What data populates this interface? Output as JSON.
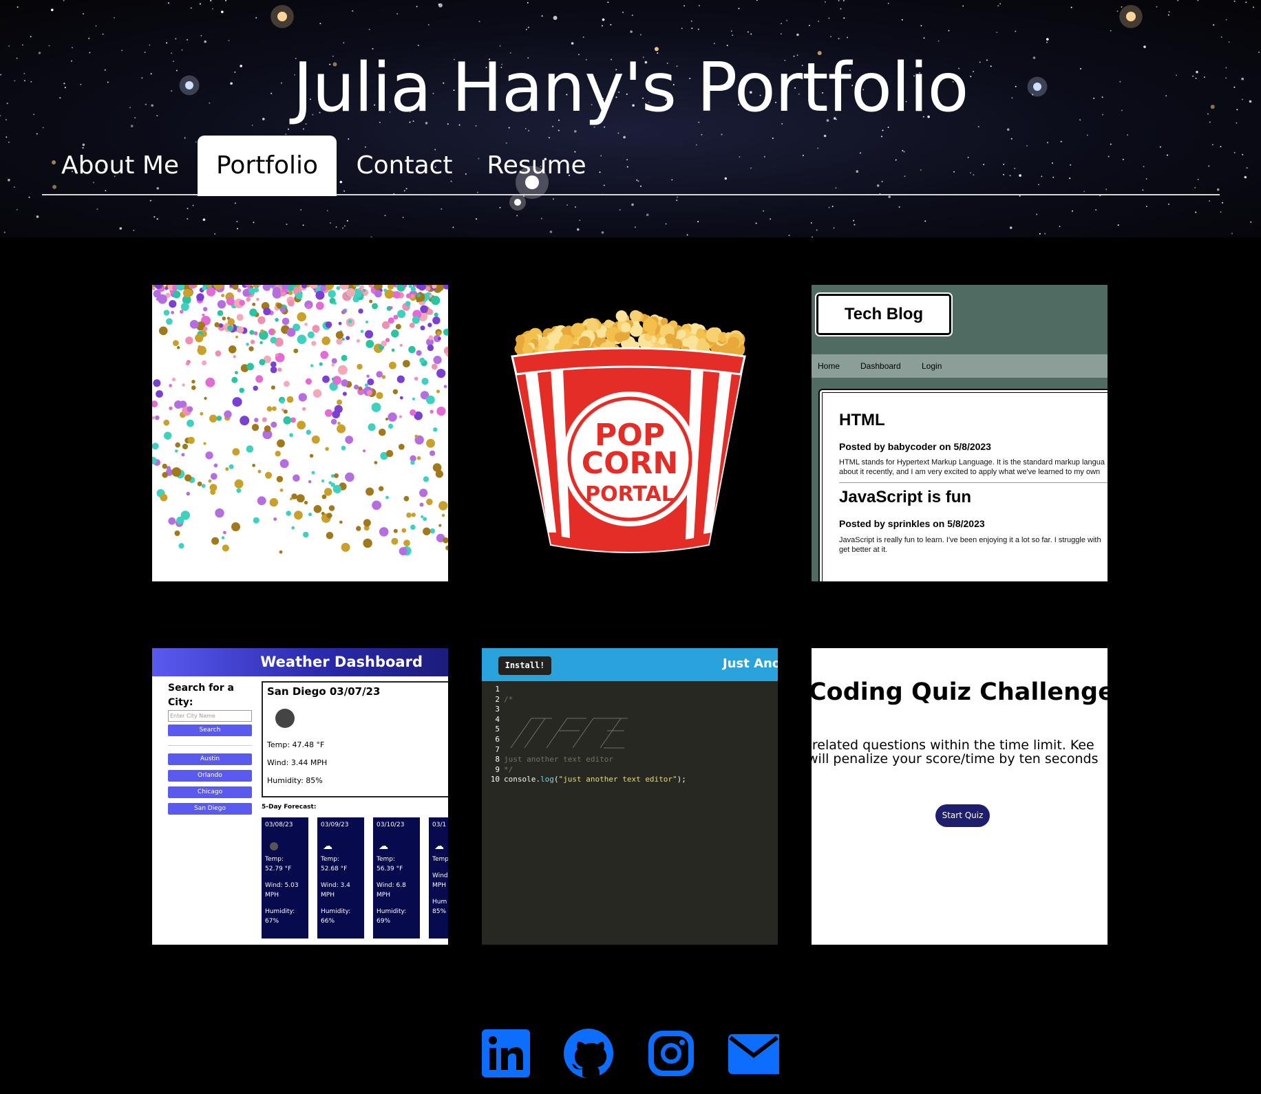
{
  "header": {
    "title": "Julia Hany's Portfolio",
    "tabs": [
      {
        "label": "About Me",
        "active": false
      },
      {
        "label": "Portfolio",
        "active": true
      },
      {
        "label": "Contact",
        "active": false
      },
      {
        "label": "Resume",
        "active": false
      }
    ]
  },
  "projects": [
    {
      "name": "confetti-project",
      "image": "confetti"
    },
    {
      "name": "popcorn-portal-project",
      "image": "popcorn bucket",
      "logo_text": "POPCORN PORTAL"
    },
    {
      "name": "tech-blog-project",
      "title": "Tech Blog",
      "nav": [
        "Home",
        "Dashboard",
        "Login"
      ],
      "posts": [
        {
          "heading": "HTML",
          "byline": "Posted by babycoder on 5/8/2023",
          "text": [
            "HTML stands for Hypertext Markup Language. It is the standard markup langua",
            "about it recently, and I am very excited to apply what we've learned to my own"
          ]
        },
        {
          "heading": "JavaScript is fun",
          "byline": "Posted by sprinkles on 5/8/2023",
          "text": [
            "JavaScript is really fun to learn. I've been enjoying it a lot so far. I struggle with",
            "get better at it."
          ]
        }
      ]
    },
    {
      "name": "weather-dashboard-project",
      "title": "Weather Dashboard",
      "search_label_1": "Search for a",
      "search_label_2": "City:",
      "search_placeholder": "Enter City Name",
      "search_button": "Search",
      "cities": [
        "Austin",
        "Orlando",
        "Chicago",
        "San Diego"
      ],
      "today": {
        "city": "San Diego 03/07/23",
        "temp": "Temp: 47.48 °F",
        "wind": "Wind: 3.44 MPH",
        "humidity": "Humidity: 85%"
      },
      "forecast_label": "5-Day Forecast:",
      "forecast": [
        {
          "date": "03/08/23",
          "temp_1": "Temp:",
          "temp_2": "52.79 °F",
          "wind_1": "Wind: 5.03",
          "wind_2": "MPH",
          "hum_1": "Humidity:",
          "hum_2": "67%"
        },
        {
          "date": "03/09/23",
          "temp_1": "Temp:",
          "temp_2": "52.68 °F",
          "wind_1": "Wind: 3.4",
          "wind_2": "MPH",
          "hum_1": "Humidity:",
          "hum_2": "66%"
        },
        {
          "date": "03/10/23",
          "temp_1": "Temp:",
          "temp_2": "56.39 °F",
          "wind_1": "Wind: 6.8",
          "wind_2": "MPH",
          "hum_1": "Humidity:",
          "hum_2": "69%"
        },
        {
          "date": "03/1",
          "temp_1": "Temp",
          "temp_2": "",
          "wind_1": "Wind",
          "wind_2": "MPH",
          "hum_1": "Hum",
          "hum_2": "85%"
        }
      ]
    },
    {
      "name": "jate-project",
      "install_label": "Install!",
      "brand": "Just Ano",
      "lines": [
        "",
        "/*",
        "",
        "",
        "",
        "",
        "",
        "just another text editor",
        "*/",
        "console.log(\"just another text editor\");"
      ]
    },
    {
      "name": "coding-quiz-project",
      "title": "Coding Quiz Challenge",
      "line_1": "-related questions within the time limit. Kee",
      "line_2": "will penalize your score/time by ten seconds",
      "start_button": "Start Quiz"
    }
  ],
  "footer": {
    "links": [
      {
        "icon": "linkedin-icon",
        "label": "in"
      },
      {
        "icon": "github-icon"
      },
      {
        "icon": "instagram-icon"
      },
      {
        "icon": "mail-icon"
      }
    ],
    "icon_color": "#0d6efd"
  }
}
